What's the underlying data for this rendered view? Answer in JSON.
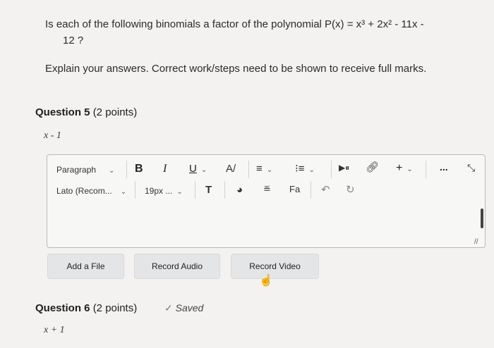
{
  "question_prompt": {
    "line1": "Is each of the following binomials a factor of the polynomial P(x) = x³ + 2x² - 11x -",
    "line2": "12 ?"
  },
  "explain": "Explain your answers. Correct work/steps need to be shown to receive full marks.",
  "question5": {
    "title": "Question 5",
    "points": "(2 points)",
    "expression": "x - 1"
  },
  "toolbar": {
    "paragraph": "Paragraph",
    "bold": "B",
    "italic": "I",
    "underline": "U",
    "font": "Lato (Recom...",
    "size": "19px ...",
    "plus": "+",
    "more": "..."
  },
  "buttons": {
    "add_file": "Add a File",
    "record_audio": "Record Audio",
    "record_video": "Record Video"
  },
  "question6": {
    "title": "Question 6",
    "points": "(2 points)",
    "saved": "Saved",
    "saved_icon": "✓",
    "expression": "x + 1"
  }
}
